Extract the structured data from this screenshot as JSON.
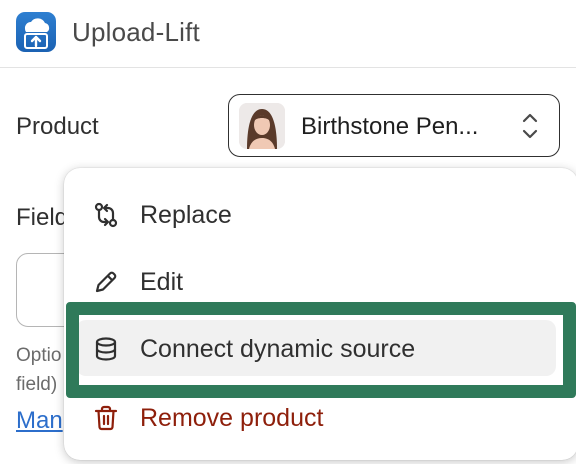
{
  "app": {
    "title": "Upload-Lift",
    "icon": "cloud-upload-icon",
    "accent": "#1b62b3"
  },
  "product": {
    "label": "Product",
    "selected_name": "Birthstone Pen...",
    "thumbnail": "product-portrait-thumbnail"
  },
  "background": {
    "field_label": "Field",
    "help_text": "Optio field)",
    "help_line1": "Optio",
    "help_line2": "field)",
    "link_text": "Man"
  },
  "menu": {
    "items": [
      {
        "label": "Replace",
        "icon": "replace-arrows-icon"
      },
      {
        "label": "Edit",
        "icon": "pencil-icon"
      },
      {
        "label": "Connect dynamic source",
        "icon": "database-icon",
        "state": "hovered"
      },
      {
        "label": "Remove product",
        "icon": "trash-icon",
        "tone": "critical"
      }
    ]
  },
  "colors": {
    "highlight": "#2f7a5a",
    "critical": "#8e1f0b",
    "link": "#2c6ecb"
  }
}
